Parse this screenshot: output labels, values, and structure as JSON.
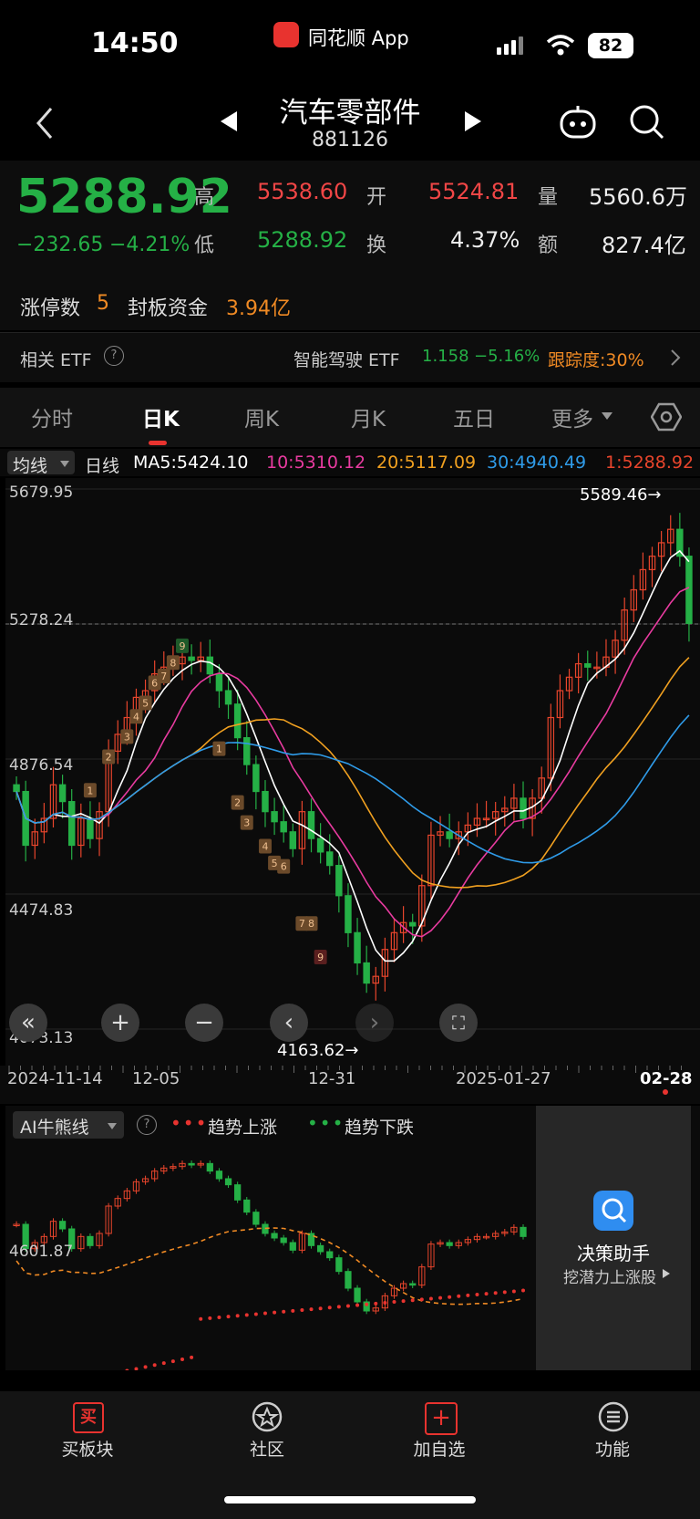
{
  "status": {
    "time": "14:50",
    "app_name": "同花顺 App",
    "battery": "82"
  },
  "nav": {
    "title": "汽车零部件",
    "code": "881126"
  },
  "quote": {
    "price": "5288.92",
    "change": "−232.65",
    "change_pct": "−4.21%",
    "high_label": "高",
    "high": "5538.60",
    "open_label": "开",
    "open": "5524.81",
    "vol_label": "量",
    "vol": "5560.6万",
    "low_label": "低",
    "low": "5288.92",
    "turn_label": "换",
    "turn": "4.37%",
    "amt_label": "额",
    "amt": "827.4亿",
    "limit_label": "涨停数",
    "limit_count": "5",
    "seal_label": "封板资金",
    "seal_amt": "3.94亿"
  },
  "etf": {
    "label": "相关 ETF",
    "name": "智能驾驶 ETF",
    "price": "1.158",
    "pct": "−5.16%",
    "track": "跟踪度:30%"
  },
  "tabs": [
    "分时",
    "日K",
    "周K",
    "月K",
    "五日",
    "更多"
  ],
  "ma": {
    "selector": "均线",
    "period": "日线",
    "ma5": "MA5:5424.10",
    "ma10": "10:5310.12",
    "ma20": "20:5117.09",
    "ma30": "30:4940.49",
    "ma1": "1:5288.92"
  },
  "chart_data": {
    "type": "candlestick",
    "y_ticks": [
      "5679.95",
      "5278.24",
      "4876.54",
      "4474.83",
      "4073.13"
    ],
    "ylim": [
      4073.13,
      5679.95
    ],
    "x_ticks": [
      "2024-11-14",
      "12-05",
      "12-31",
      "2025-01-27",
      "02-28"
    ],
    "max_label": "5589.46→",
    "min_label": "4163.62→",
    "last_close": 5278.24,
    "colors": {
      "up": "#e8452c",
      "down": "#25b046",
      "ma5": "#ffffff",
      "ma10": "#e83ba0",
      "ma20": "#f0a020",
      "ma30": "#2f9be8"
    },
    "td_up_counts": [
      "1",
      "2",
      "3",
      "4",
      "5",
      "6",
      "7",
      "8",
      "9"
    ],
    "td_down_counts": [
      "1",
      "2",
      "3",
      "4",
      "5",
      "6",
      "7",
      "8",
      "9"
    ]
  },
  "ai": {
    "selector": "AI牛熊线",
    "help": "?",
    "up": "趋势上涨",
    "down": "趋势下跌",
    "price_tag": "4601.87"
  },
  "assistant": {
    "title": "决策助手",
    "sub": "挖潜力上涨股"
  },
  "bottom_nav": [
    "买板块",
    "社区",
    "加自选",
    "功能"
  ]
}
